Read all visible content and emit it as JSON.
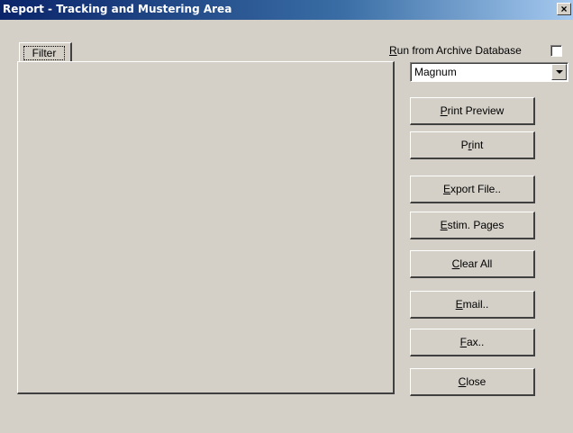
{
  "window": {
    "title": "Report  - Tracking and Mustering Area",
    "close_glyph": "×"
  },
  "tabs": [
    {
      "label": "Filter"
    }
  ],
  "archive": {
    "label_prefix": "R",
    "label_rest": "un from Archive Database",
    "checked": false
  },
  "database_select": {
    "value": "Magnum"
  },
  "buttons": {
    "print_preview": {
      "pre": "",
      "key": "P",
      "post": "rint Preview"
    },
    "print": {
      "pre": "P",
      "key": "r",
      "post": "int"
    },
    "export_file": {
      "pre": "",
      "key": "E",
      "post": "xport File.."
    },
    "estim_pages": {
      "pre": "",
      "key": "E",
      "post": "stim. Pages"
    },
    "clear_all": {
      "pre": "",
      "key": "C",
      "post": "lear All"
    },
    "email": {
      "pre": "",
      "key": "E",
      "post": "mail.."
    },
    "fax": {
      "pre": "",
      "key": "F",
      "post": "ax.."
    },
    "close": {
      "pre": "",
      "key": "C",
      "post": "lose"
    }
  },
  "colors": {
    "face": "#d4d0c8",
    "title_start": "#0a246a",
    "title_end": "#a6caf0"
  }
}
